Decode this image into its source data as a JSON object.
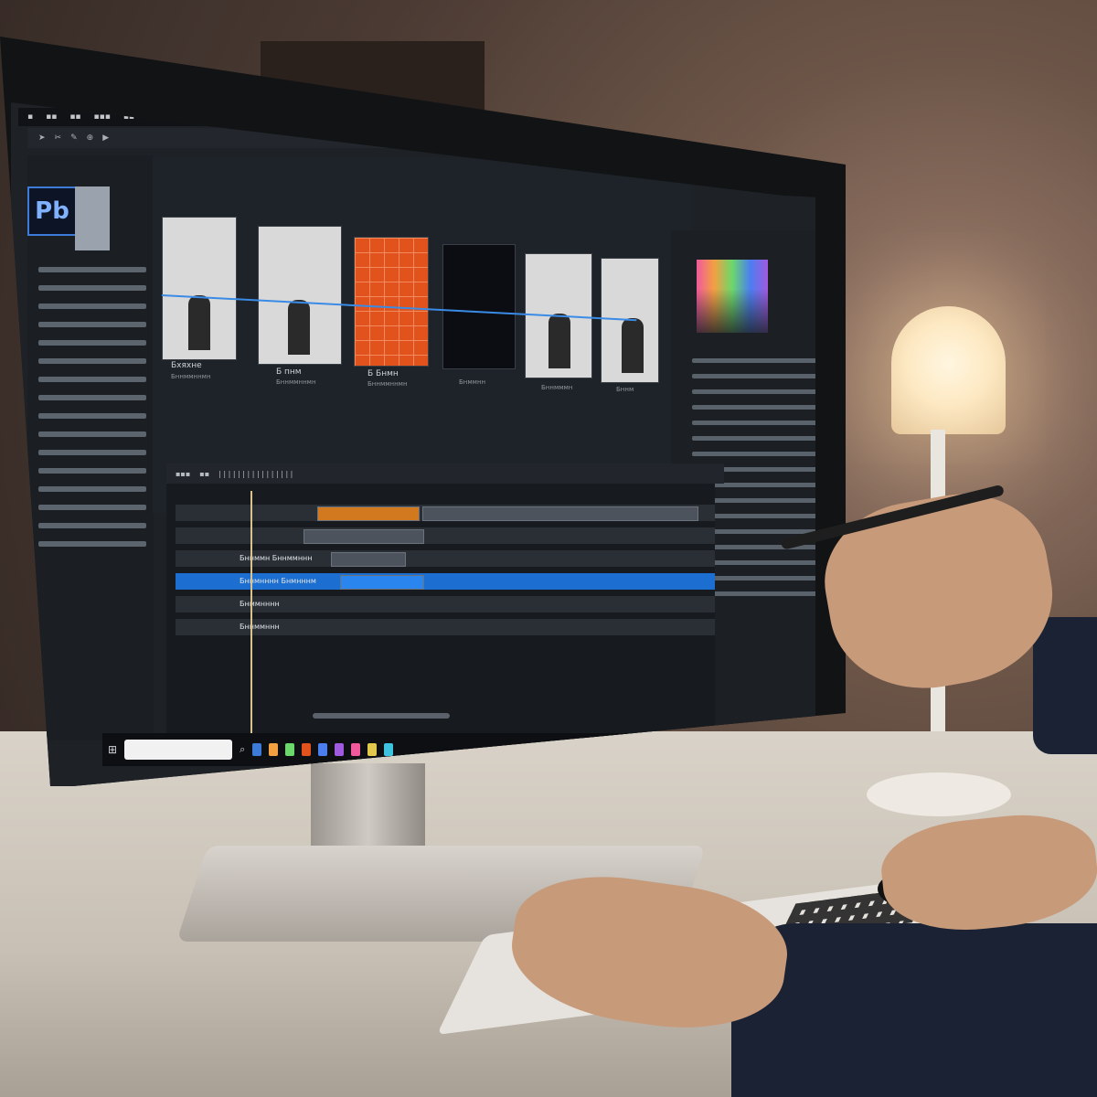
{
  "app": {
    "logo_text": "Pb"
  },
  "preview": {
    "frames": [
      {
        "title": "Бхяхне",
        "subtitle": "Бннммннмн",
        "style": "light"
      },
      {
        "title": "Б пнм",
        "subtitle": "Бннммннмн",
        "style": "light"
      },
      {
        "title": "Б Бнмн",
        "subtitle": "Бннммннмн",
        "style": "orange"
      },
      {
        "title": "",
        "subtitle": "Бнммнн",
        "style": "dark"
      },
      {
        "title": "",
        "subtitle": "Бннмммн",
        "style": "light"
      },
      {
        "title": "",
        "subtitle": "Бннм",
        "style": "light"
      }
    ]
  },
  "timeline": {
    "tracks": [
      {
        "label": ""
      },
      {
        "label": "Бннммн Бннммннн"
      },
      {
        "label": "Бннмнннн Бнмнннм"
      },
      {
        "label": "Бнммнннн"
      },
      {
        "label": "Бннммннн"
      }
    ],
    "selected_track_index": 2
  },
  "colors": {
    "accent_blue": "#1c6fd0",
    "frame_orange": "#e2521d",
    "playhead": "#d9c290"
  },
  "icons": [
    "logo-icon",
    "play-icon",
    "pen-icon",
    "search-icon",
    "windows-icon"
  ]
}
